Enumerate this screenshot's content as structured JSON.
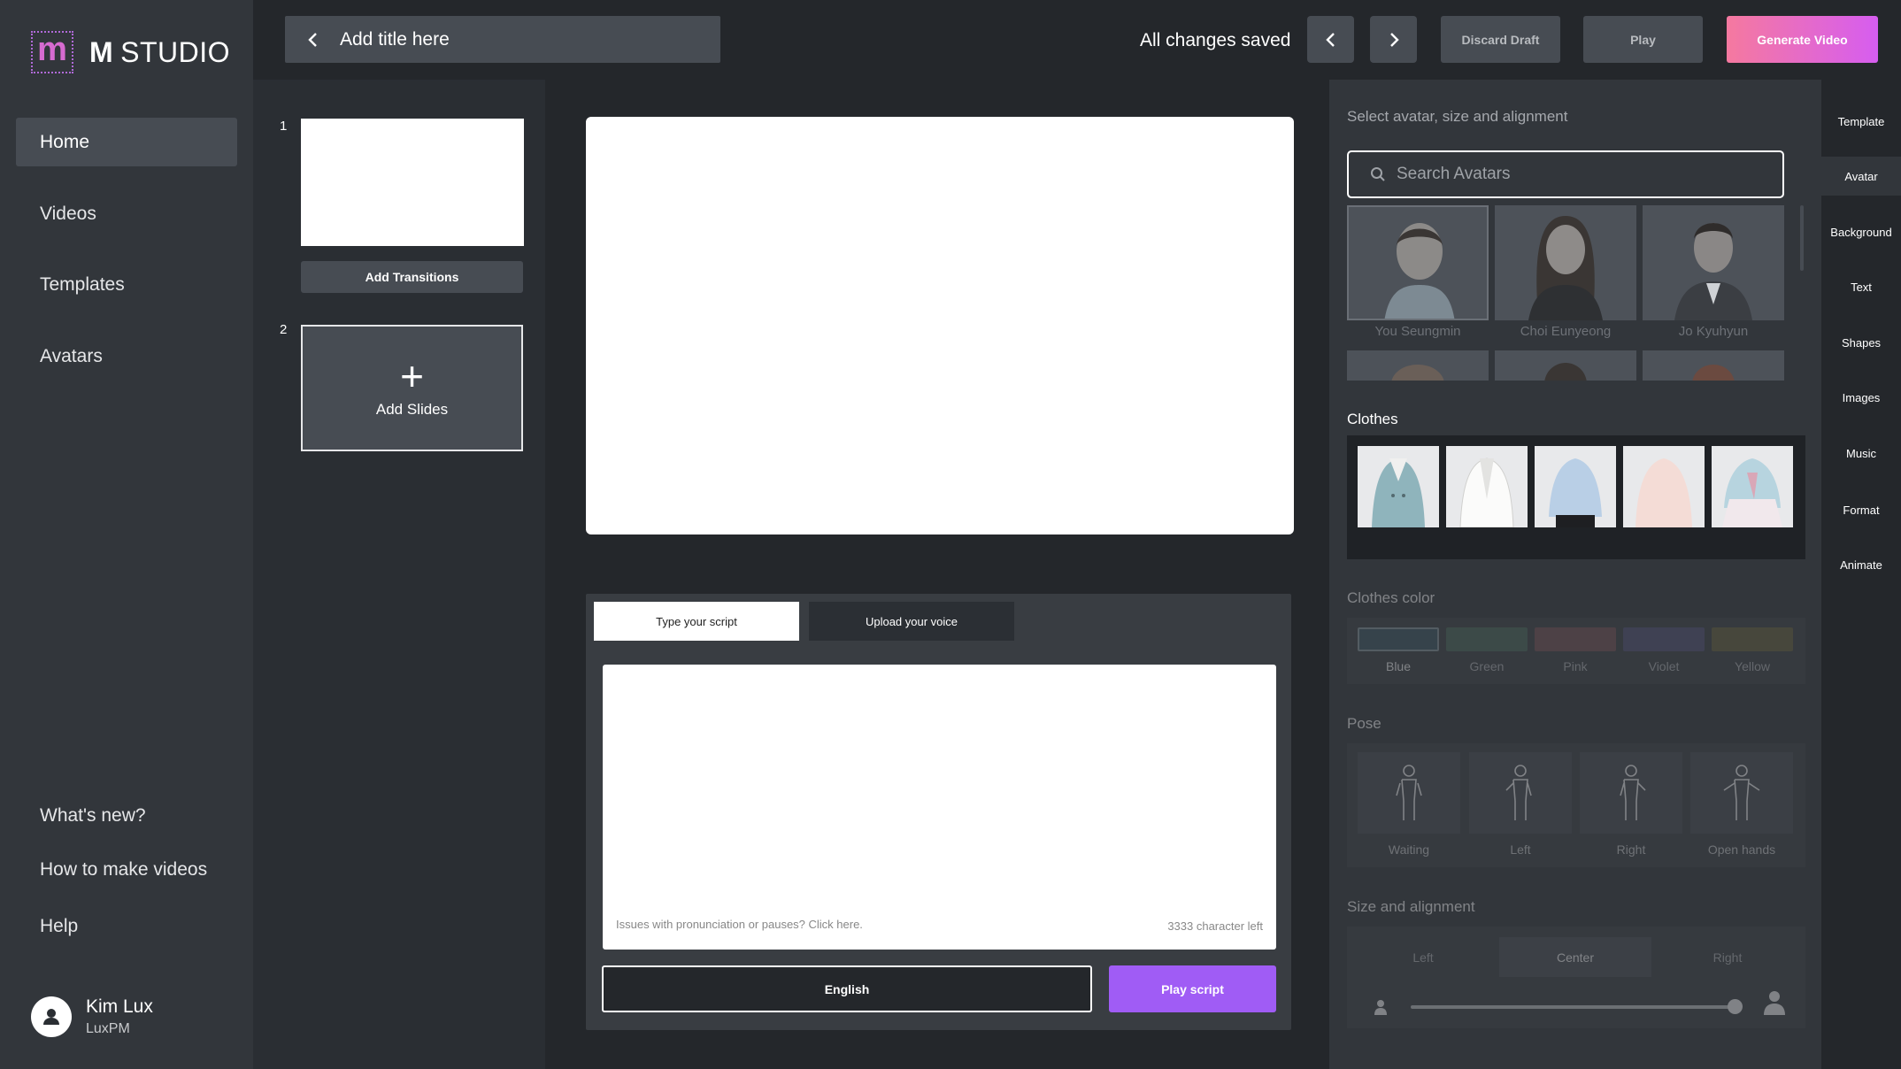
{
  "app": {
    "logo_letter": "m",
    "name_bold": "M",
    "name_rest": "STUDIO"
  },
  "nav": {
    "items": [
      {
        "label": "Home",
        "active": true
      },
      {
        "label": "Videos"
      },
      {
        "label": "Templates"
      },
      {
        "label": "Avatars"
      }
    ],
    "bottom": [
      {
        "label": "What's new?"
      },
      {
        "label": "How to make videos"
      },
      {
        "label": "Help"
      }
    ]
  },
  "user": {
    "name": "Kim Lux",
    "org": "LuxPM"
  },
  "header": {
    "title": "Add title here",
    "status": "All changes saved",
    "discard_label": "Discard Draft",
    "play_label": "Play",
    "generate_label": "Generate Video"
  },
  "slides": {
    "items": [
      {
        "number": "1"
      },
      {
        "number": "2"
      }
    ],
    "add_transitions_label": "Add Transitions",
    "add_slides_label": "Add Slides"
  },
  "script": {
    "tabs": [
      {
        "label": "Type your script",
        "active": true
      },
      {
        "label": "Upload your voice"
      }
    ],
    "hint": "Issues with pronunciation or pauses? Click here.",
    "chars_left": "3333 character left",
    "language": "English",
    "play_label": "Play script"
  },
  "panel": {
    "heading": "Select avatar, size and alignment",
    "search_placeholder": "Search Avatars",
    "avatars": [
      {
        "name": "You Seungmin",
        "selected": true
      },
      {
        "name": "Choi Eunyeong"
      },
      {
        "name": "Jo Kyuhyun"
      }
    ],
    "clothes_label": "Clothes",
    "clothes": [
      {
        "name": "teal-double-breasted-jacket",
        "color": "#8fb4bc"
      },
      {
        "name": "white-blazer",
        "color": "#f2f2f0"
      },
      {
        "name": "light-blue-shirt",
        "color": "#b9cfe6"
      },
      {
        "name": "pink-sweater",
        "color": "#f4dcd6"
      },
      {
        "name": "hanbok",
        "color": "#b7d4df"
      }
    ],
    "clothes_color_label": "Clothes color",
    "colors": [
      {
        "label": "Blue",
        "hex": "#3f5a66"
      },
      {
        "label": "Green",
        "hex": "#4d6b5e"
      },
      {
        "label": "Pink",
        "hex": "#7a5458"
      },
      {
        "label": "Violet",
        "hex": "#55557c"
      },
      {
        "label": "Yellow",
        "hex": "#6b633e"
      }
    ],
    "pose_label": "Pose",
    "poses": [
      {
        "label": "Waiting"
      },
      {
        "label": "Left"
      },
      {
        "label": "Right"
      },
      {
        "label": "Open hands"
      }
    ],
    "size_label": "Size and alignment",
    "alignments": [
      {
        "label": "Left"
      },
      {
        "label": "Center",
        "active": true
      },
      {
        "label": "Right"
      }
    ],
    "size_value": 1.0
  },
  "rail": {
    "items": [
      {
        "label": "Template"
      },
      {
        "label": "Avatar",
        "active": true
      },
      {
        "label": "Background"
      },
      {
        "label": "Text"
      },
      {
        "label": "Shapes"
      },
      {
        "label": "Images"
      },
      {
        "label": "Music"
      },
      {
        "label": "Format"
      },
      {
        "label": "Animate"
      }
    ]
  }
}
